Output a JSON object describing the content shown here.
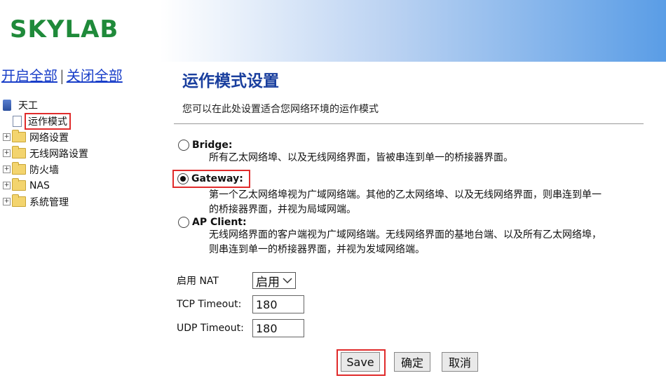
{
  "logo": "SKYLAB",
  "toggle": {
    "expand_all": "开启全部",
    "collapse_all": "关闭全部",
    "separator": "|"
  },
  "tree": {
    "root": "天工",
    "selected": "运作模式",
    "items": [
      "网络设置",
      "无线网路设置",
      "防火墙",
      "NAS",
      "系統管理"
    ]
  },
  "page": {
    "title": "运作模式设置",
    "description": "您可以在此处设置适合您网络环境的运作模式"
  },
  "modes": {
    "bridge": {
      "label": "Bridge:",
      "text": "所有乙太网络埠、以及无线网络界面，皆被串连到单一的桥接器界面。"
    },
    "gateway": {
      "label": "Gateway:",
      "text1": "第一个乙太网络埠视为广域网络端。其他的乙太网络埠、以及无线网络界面，则串连到单一",
      "text2": "的桥接器界面，并视为局域网端。"
    },
    "apclient": {
      "label": "AP Client:",
      "text1": "无线网络界面的客户端视为广域网络端。无线网络界面的基地台端、以及所有乙太网络埠，",
      "text2": "则串连到单一的桥接器界面，并视为发域网络端。"
    },
    "selected": "gateway"
  },
  "form": {
    "nat_label": "启用 NAT",
    "nat_value": "启用",
    "tcp_label": "TCP Timeout:",
    "tcp_value": "180",
    "udp_label": "UDP Timeout:",
    "udp_value": "180"
  },
  "buttons": {
    "save": "Save",
    "confirm": "确定",
    "cancel": "取消"
  },
  "colors": {
    "accent_red": "#e02b2b",
    "title_blue": "#1a3f9e",
    "logo_green": "#1f8a3a",
    "link_blue": "#1a3fc9"
  }
}
